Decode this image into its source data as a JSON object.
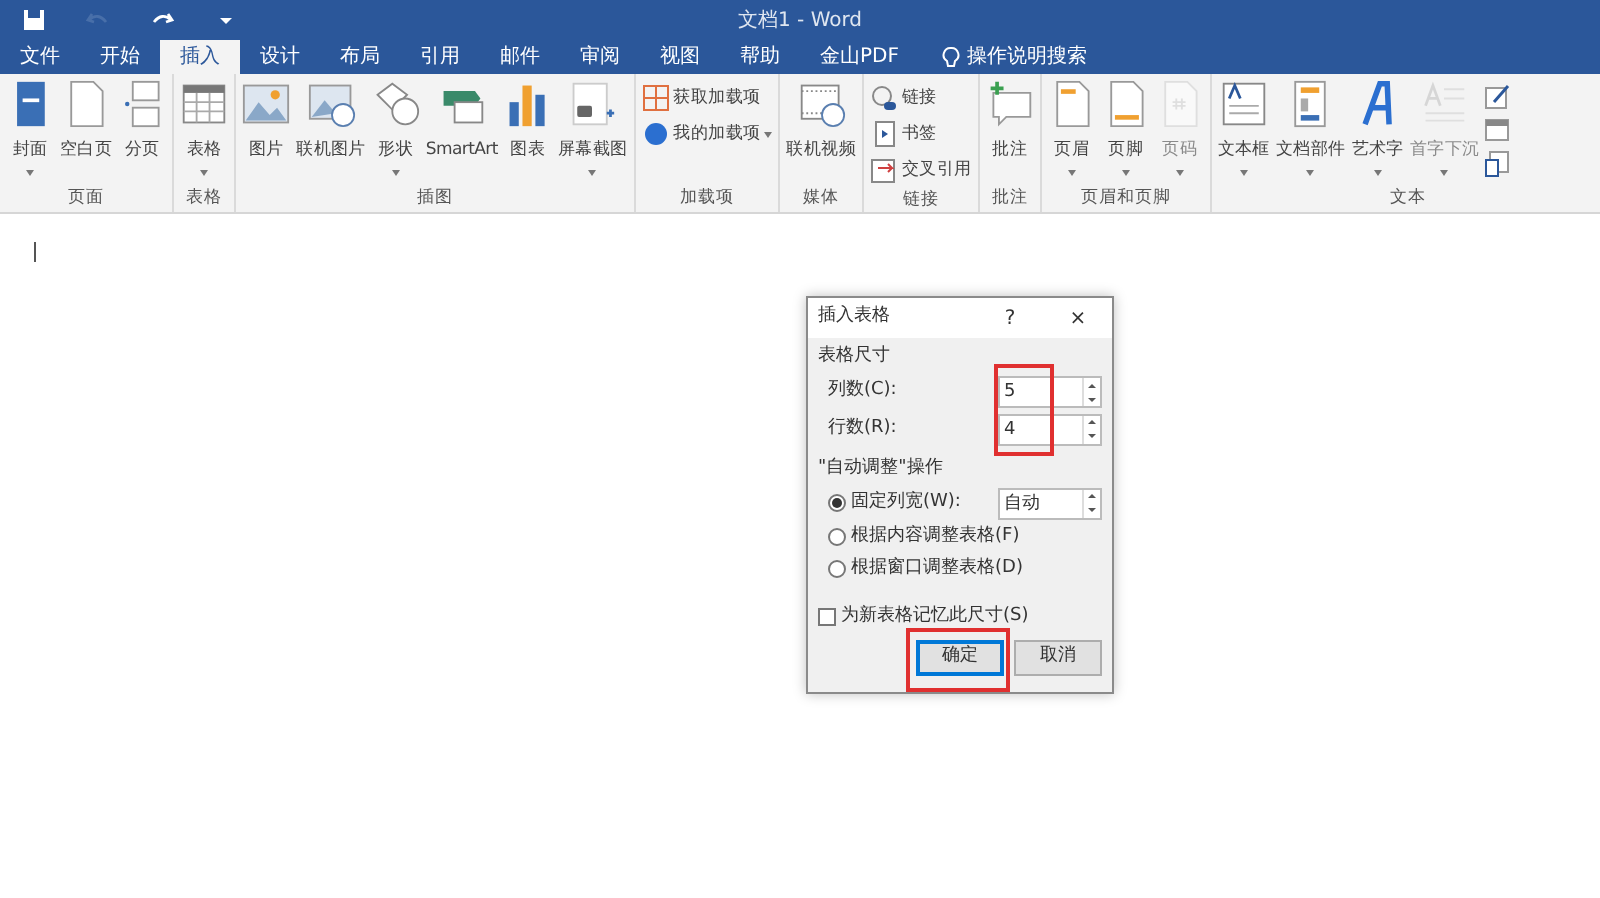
{
  "window": {
    "title": "文档1  -  Word"
  },
  "quick_access": [
    {
      "kind": "save",
      "disabled": false
    },
    {
      "kind": "undo",
      "disabled": true
    },
    {
      "kind": "redo",
      "disabled": false
    },
    {
      "kind": "customize",
      "disabled": false
    }
  ],
  "tabs": [
    {
      "label": "文件",
      "selected": false
    },
    {
      "label": "开始",
      "selected": false
    },
    {
      "label": "插入",
      "selected": true
    },
    {
      "label": "设计",
      "selected": false
    },
    {
      "label": "布局",
      "selected": false
    },
    {
      "label": "引用",
      "selected": false
    },
    {
      "label": "邮件",
      "selected": false
    },
    {
      "label": "审阅",
      "selected": false
    },
    {
      "label": "视图",
      "selected": false
    },
    {
      "label": "帮助",
      "selected": false
    },
    {
      "label": "金山PDF",
      "selected": false
    }
  ],
  "tell_me": {
    "label": "操作说明搜索"
  },
  "ribbon_groups": [
    {
      "label": "页面",
      "items": [
        {
          "kind": "large",
          "label": "封面",
          "dropdown": true,
          "disabled": false
        },
        {
          "kind": "large",
          "label": "空白页",
          "dropdown": false,
          "disabled": false
        },
        {
          "kind": "large",
          "label": "分页",
          "dropdown": false,
          "disabled": false
        }
      ]
    },
    {
      "label": "表格",
      "items": [
        {
          "kind": "large",
          "label": "表格",
          "dropdown": true,
          "disabled": false
        }
      ]
    },
    {
      "label": "插图",
      "items": [
        {
          "kind": "large",
          "label": "图片",
          "dropdown": false,
          "disabled": false
        },
        {
          "kind": "large",
          "label": "联机图片",
          "dropdown": false,
          "disabled": false
        },
        {
          "kind": "large",
          "label": "形状",
          "dropdown": true,
          "disabled": false
        },
        {
          "kind": "large",
          "label": "SmartArt",
          "dropdown": false,
          "disabled": false
        },
        {
          "kind": "large",
          "label": "图表",
          "dropdown": false,
          "disabled": false
        },
        {
          "kind": "large",
          "label": "屏幕截图",
          "dropdown": true,
          "disabled": false
        }
      ]
    },
    {
      "label": "加载项",
      "items": [
        {
          "kind": "small",
          "label": "获取加载项",
          "dropdown": false,
          "disabled": false
        },
        {
          "kind": "small",
          "label": "我的加载项",
          "dropdown": true,
          "disabled": false
        }
      ]
    },
    {
      "label": "媒体",
      "items": [
        {
          "kind": "large",
          "label": "联机视频",
          "dropdown": false,
          "disabled": false
        }
      ]
    },
    {
      "label": "链接",
      "items": [
        {
          "kind": "small",
          "label": "链接",
          "dropdown": false,
          "disabled": false
        },
        {
          "kind": "small",
          "label": "书签",
          "dropdown": false,
          "disabled": false
        },
        {
          "kind": "small",
          "label": "交叉引用",
          "dropdown": false,
          "disabled": false
        }
      ]
    },
    {
      "label": "批注",
      "items": [
        {
          "kind": "large",
          "label": "批注",
          "dropdown": false,
          "disabled": false
        }
      ]
    },
    {
      "label": "页眉和页脚",
      "items": [
        {
          "kind": "large",
          "label": "页眉",
          "dropdown": true,
          "disabled": false
        },
        {
          "kind": "large",
          "label": "页脚",
          "dropdown": true,
          "disabled": false
        },
        {
          "kind": "large",
          "label": "页码",
          "dropdown": true,
          "disabled": true
        }
      ]
    },
    {
      "label": "文本",
      "items": [
        {
          "kind": "large",
          "label": "文本框",
          "dropdown": true,
          "disabled": false
        },
        {
          "kind": "large",
          "label": "文档部件",
          "dropdown": true,
          "disabled": false
        },
        {
          "kind": "large",
          "label": "艺术字",
          "dropdown": true,
          "disabled": false
        },
        {
          "kind": "large",
          "label": "首字下沉",
          "dropdown": true,
          "disabled": true
        },
        {
          "kind": "icon_stack"
        }
      ]
    }
  ],
  "dialog": {
    "title": "插入表格",
    "help": "?",
    "close": "×",
    "size_section": {
      "label": "表格尺寸",
      "highlighted": true,
      "fields": [
        {
          "label": "列数(C):",
          "value": "5"
        },
        {
          "label": "行数(R):",
          "value": "4"
        }
      ]
    },
    "autofit_section": {
      "label": "\"自动调整\"操作",
      "options": [
        {
          "label": "固定列宽(W):",
          "selected": true,
          "value": "自动"
        },
        {
          "label": "根据内容调整表格(F)",
          "selected": false
        },
        {
          "label": "根据窗口调整表格(D)",
          "selected": false
        }
      ]
    },
    "remember": {
      "label": "为新表格记忆此尺寸(S)",
      "checked": false
    },
    "buttons": [
      {
        "label": "确定",
        "default": true,
        "highlighted": true
      },
      {
        "label": "取消",
        "default": false,
        "highlighted": false
      }
    ]
  }
}
